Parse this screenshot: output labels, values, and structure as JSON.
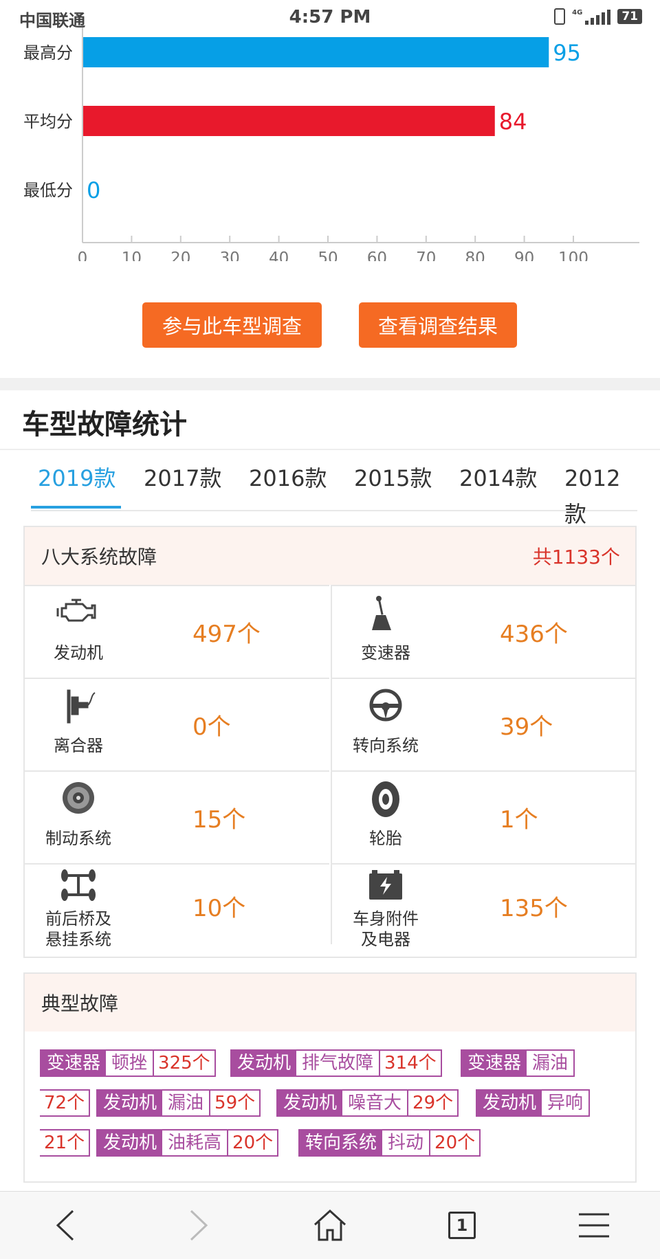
{
  "status_bar": {
    "carrier": "中国联通",
    "time": "4:57 PM",
    "network": "4G",
    "battery": "71"
  },
  "score_chart": {
    "chart_data": {
      "type": "bar",
      "orientation": "horizontal",
      "categories": [
        "最高分",
        "平均分",
        "最低分"
      ],
      "values": [
        95,
        84,
        0
      ],
      "colors": [
        "#069fe6",
        "#e8192c",
        "#069fe6"
      ],
      "value_label_colors": [
        "#069fe6",
        "#e8192c",
        "#069fe6"
      ],
      "xlim": [
        0,
        100
      ],
      "xticks": [
        0,
        10,
        20,
        30,
        40,
        50,
        60,
        70,
        80,
        90,
        100
      ],
      "grid": false
    }
  },
  "buttons": {
    "join_survey": "参与此车型调查",
    "view_results": "查看调查结果"
  },
  "section": {
    "title": "车型故障统计"
  },
  "tabs": [
    "2019款",
    "2017款",
    "2016款",
    "2015款",
    "2014款",
    "2012款"
  ],
  "system_faults": {
    "title": "八大系统故障",
    "total": "共1133个",
    "items": [
      {
        "icon": "engine-icon",
        "label": "发动机",
        "count": "497个"
      },
      {
        "icon": "gear-shifter-icon",
        "label": "变速器",
        "count": "436个"
      },
      {
        "icon": "clutch-icon",
        "label": "离合器",
        "count": "0个"
      },
      {
        "icon": "steering-wheel-icon",
        "label": "转向系统",
        "count": "39个"
      },
      {
        "icon": "brake-disc-icon",
        "label": "制动系统",
        "count": "15个"
      },
      {
        "icon": "tire-icon",
        "label": "轮胎",
        "count": "1个"
      },
      {
        "icon": "axle-suspension-icon",
        "label": "前后桥及\n悬挂系统",
        "count": "10个"
      },
      {
        "icon": "battery-electrical-icon",
        "label": "车身附件\n及电器",
        "count": "135个"
      }
    ]
  },
  "typical_faults": {
    "title": "典型故障",
    "tags": [
      {
        "system": "变速器",
        "phenomenon": "顿挫",
        "count": "325个"
      },
      {
        "system": "发动机",
        "phenomenon": "排气故障",
        "count": "314个"
      },
      {
        "system": "变速器",
        "phenomenon": "漏油",
        "count": "72个"
      },
      {
        "system": "发动机",
        "phenomenon": "漏油",
        "count": "59个"
      },
      {
        "system": "发动机",
        "phenomenon": "噪音大",
        "count": "29个"
      },
      {
        "system": "发动机",
        "phenomenon": "异响",
        "count": "21个"
      },
      {
        "system": "发动机",
        "phenomenon": "油耗高",
        "count": "20个"
      },
      {
        "system": "转向系统",
        "phenomenon": "抖动",
        "count": "20个"
      }
    ]
  },
  "bottom_nav": {
    "tab_count": "1"
  }
}
